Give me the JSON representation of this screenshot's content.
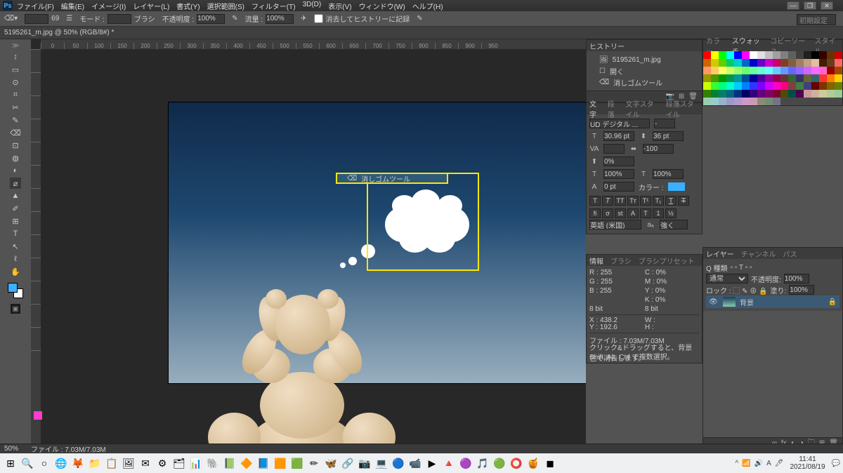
{
  "menu": {
    "items": [
      "ファイル(F)",
      "編集(E)",
      "イメージ(I)",
      "レイヤー(L)",
      "書式(Y)",
      "選択範囲(S)",
      "フィルター(T)",
      "3D(D)",
      "表示(V)",
      "ウィンドウ(W)",
      "ヘルプ(H)"
    ]
  },
  "window": {
    "min": "—",
    "max": "❐",
    "close": "✕"
  },
  "options": {
    "brush_size": "69",
    "mode_label": "モード :",
    "mode_value": "ブラシ",
    "opacity_label": "不透明度 :",
    "opacity_value": "100%",
    "flow_label": "流量 :",
    "flow_value": "100%",
    "erase_history": "消去してヒストリーに記録",
    "search_placeholder": "初期設定"
  },
  "doc": {
    "tab": "5195261_m.jpg @ 50% (RGB/8#) *"
  },
  "tools": [
    "↕",
    "▭",
    "⊙",
    "⌗",
    "✂",
    "✎",
    "⌫",
    "⊡",
    "◍",
    "◐",
    "⌀",
    "▲",
    "✐",
    "⊞",
    "T",
    "↖",
    "ℓ",
    "✋",
    "🔍"
  ],
  "history": {
    "title": "ヒストリー",
    "items": [
      {
        "label": "5195261_m.jpg",
        "selected": false,
        "icon": "🖼"
      },
      {
        "label": "開く",
        "selected": false,
        "icon": "☐"
      },
      {
        "label": "消しゴムツール",
        "selected": false,
        "icon": "⌫"
      },
      {
        "label": "消しゴムツール",
        "selected": true,
        "icon": "⌫"
      }
    ]
  },
  "char": {
    "tabs": [
      "文字",
      "段落",
      "文字スタイル",
      "段落スタイル"
    ],
    "font": "UD デジタル ...",
    "style": "-",
    "size": "30.96 pt",
    "leading": "36 pt",
    "va": "VA",
    "tracking": "-100",
    "scale": "0%",
    "hscale": "100%",
    "vscale": "100%",
    "baseline": "0 pt",
    "color_label": "カラー :",
    "lang": "英語 (米国)",
    "aa": "強く"
  },
  "right_tabs": {
    "color": [
      "カラー",
      "スウォッチ",
      "コピーソース",
      "スタイル"
    ]
  },
  "info": {
    "tabs": [
      "情報",
      "ブラシ",
      "ブラシプリセット"
    ],
    "r": "R :",
    "rv": "255",
    "c": "C :",
    "cv": "0%",
    "g": "G :",
    "gv": "255",
    "m": "M :",
    "mv": "0%",
    "b": "B :",
    "bv": "255",
    "y": "Y :",
    "yv": "0%",
    "k": "K :",
    "kv": "0%",
    "bit": "8 bit",
    "bit2": "8 bit",
    "x": "X :",
    "xv": "438.2",
    "w": "W :",
    "wv": "",
    "yl": "Y :",
    "ylv": "192.6",
    "h": "H :",
    "hv": "",
    "file": "ファイル : 7.03M/7.03M",
    "hint1": "クリック&ドラッグすると、背景色で消去します。",
    "hint2": "Shift, Alt, Ctrl で複数選択。"
  },
  "layers": {
    "tabs": [
      "レイヤー",
      "チャンネル",
      "パス"
    ],
    "kind": "Q 種類",
    "blend": "通常",
    "opacity_label": "不透明度:",
    "opacity": "100%",
    "lock": "ロック : ⬚ ✎ ⊕ 🔒",
    "fill_label": "塗り:",
    "fill": "100%",
    "layer0": "背景",
    "locked": "🔒"
  },
  "status": {
    "zoom": "50%",
    "doc": "ファイル : 7.03M/7.03M"
  },
  "taskbar": {
    "icons": [
      "⊞",
      "🔍",
      "○",
      "🌐",
      "🦊",
      "📁",
      "📋",
      "🖼",
      "✉",
      "⚙",
      "🗂",
      "📊",
      "🐘",
      "📗",
      "🔶",
      "📘",
      "🟧",
      "🟩",
      "✏",
      "🦋",
      "🔗",
      "📷",
      "💻",
      "🔵",
      "📹",
      "▶",
      "🔺",
      "🟣",
      "🎵",
      "🟢",
      "⭕",
      "🍯",
      "◼"
    ],
    "tray": [
      "^",
      "📶",
      "🔊",
      "A",
      "🖊"
    ],
    "time": "11:41",
    "date": "2021/08/19"
  },
  "swatch_colors": [
    "#ff0000",
    "#ffff00",
    "#00ff00",
    "#00ffff",
    "#0000ff",
    "#ff00ff",
    "#ffffff",
    "#e0e0e0",
    "#c0c0c0",
    "#a0a0a0",
    "#808080",
    "#606060",
    "#404040",
    "#202020",
    "#000000",
    "#330000",
    "#663300",
    "#cc0000",
    "#cc6600",
    "#cccc00",
    "#66cc00",
    "#00cc66",
    "#00cccc",
    "#0066cc",
    "#0000cc",
    "#6600cc",
    "#cc00cc",
    "#cc0066",
    "#804020",
    "#806040",
    "#a08060",
    "#c0a080",
    "#e0c0a0",
    "#402000",
    "#604020",
    "#ff6666",
    "#ff9966",
    "#ffcc66",
    "#ffff66",
    "#ccff66",
    "#99ff66",
    "#66ff66",
    "#66ff99",
    "#66ffcc",
    "#66ffff",
    "#66ccff",
    "#6699ff",
    "#6666ff",
    "#9966ff",
    "#cc66ff",
    "#ff66ff",
    "#ff66cc",
    "#990000",
    "#994c00",
    "#999900",
    "#4c9900",
    "#009900",
    "#00994c",
    "#009999",
    "#004c99",
    "#000099",
    "#4c0099",
    "#990099",
    "#99004c",
    "#663333",
    "#336633",
    "#333366",
    "#666633",
    "#336666",
    "#ff3333",
    "#ff8000",
    "#ffcc00",
    "#ccff00",
    "#33ff33",
    "#00ff80",
    "#00ffcc",
    "#00ccff",
    "#0080ff",
    "#3333ff",
    "#8000ff",
    "#cc00ff",
    "#ff00cc",
    "#ff0080",
    "#804040",
    "#408040",
    "#404080",
    "#660000",
    "#803300",
    "#806600",
    "#668000",
    "#338000",
    "#008033",
    "#008066",
    "#006680",
    "#003380",
    "#000066",
    "#330080",
    "#660080",
    "#800066",
    "#800033",
    "#4d4d00",
    "#004d4d",
    "#4d004d",
    "#cc9999",
    "#ccb299",
    "#cccc99",
    "#b2cc99",
    "#99cc99",
    "#99ccb2",
    "#99cccc",
    "#99b2cc",
    "#9999cc",
    "#b299cc",
    "#cc99cc",
    "#cc99b2",
    "#8c8c73",
    "#738c73",
    "#73738c"
  ]
}
